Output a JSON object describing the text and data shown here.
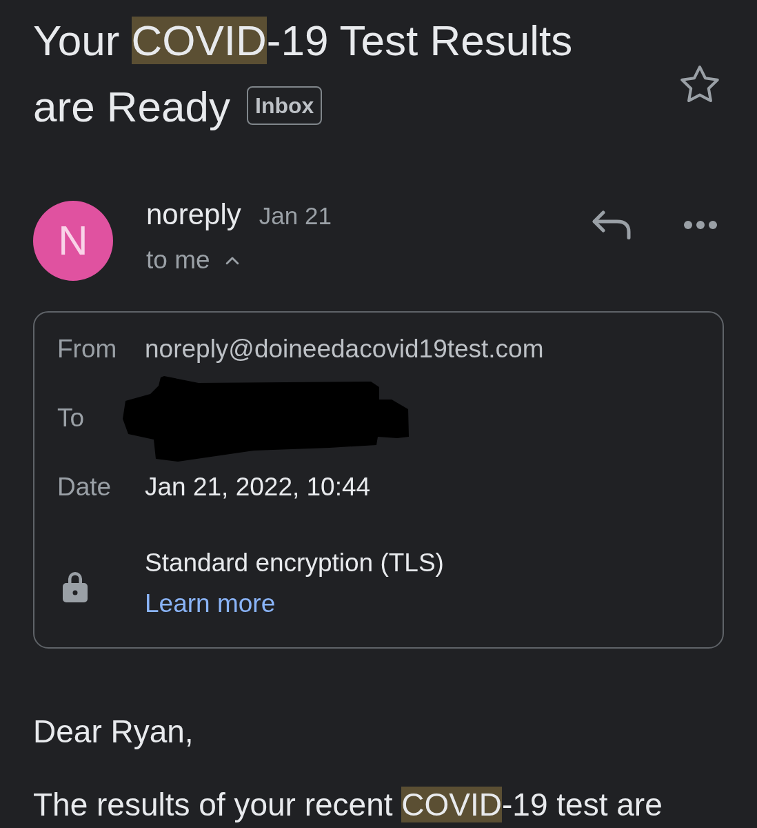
{
  "email": {
    "subject": [
      {
        "text": "Your ",
        "highlighted": false
      },
      {
        "text": "COVID",
        "highlighted": true
      },
      {
        "text": "-19 Test Results are Ready",
        "highlighted": false
      }
    ],
    "label": "Inbox",
    "starred": false
  },
  "sender": {
    "initial": "N",
    "name": "noreply",
    "date": "Jan 21",
    "recipient_summary": "to me",
    "details_expanded": true
  },
  "details": {
    "rows": [
      {
        "label": "From",
        "kind": "address",
        "value": "noreply@doineedacovid19test.com"
      },
      {
        "label": "To",
        "kind": "redacted"
      },
      {
        "label": "Date",
        "kind": "date",
        "value": "Jan 21, 2022, 10:44"
      }
    ],
    "security": {
      "text": "Standard encryption (TLS)",
      "link": "Learn more"
    }
  },
  "body": {
    "paragraphs": [
      {
        "segments": [
          {
            "text": "Dear Ryan,",
            "highlighted": false
          }
        ]
      },
      {
        "segments": [
          {
            "text": "The results of your recent ",
            "highlighted": false
          },
          {
            "text": "COVID",
            "highlighted": true
          },
          {
            "text": "-19 test are",
            "highlighted": false
          }
        ]
      }
    ]
  }
}
